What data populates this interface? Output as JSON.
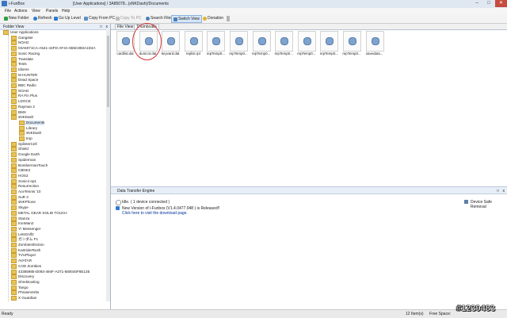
{
  "titlebar": {
    "app_title": "i-FunBox",
    "path": "[User Applications] / 3A85078...(sNKDash)/Documents"
  },
  "menu": [
    "File",
    "Actions",
    "View",
    "Panels",
    "Help"
  ],
  "toolbar": [
    {
      "label": "New Folder",
      "color": "#2f9e44"
    },
    {
      "label": "Refresh",
      "color": "#2b7bd1"
    },
    {
      "label": "Go Up Level",
      "color": "#2b7bd1"
    },
    {
      "label": "Copy From PC",
      "color": "#5b8fc7"
    },
    {
      "label": "Copy To PC",
      "color": "#9a9a9a",
      "disabled": true
    },
    {
      "label": "Search Files",
      "color": "#4b7fb5"
    },
    {
      "label": "Switch View",
      "color": "#4b7fb5",
      "active": true
    },
    {
      "label": "Donation",
      "color": "#e3b330"
    }
  ],
  "folder_view": {
    "title": "Folder View",
    "items": [
      {
        "label": "User Applications",
        "depth": 0
      },
      {
        "label": "Gangster",
        "depth": 1
      },
      {
        "label": "NOAD",
        "depth": 1
      },
      {
        "label": "03A5071CA-A541-44FD-AF4A-555C893A1D4A",
        "depth": 1
      },
      {
        "label": "Sonic Racing",
        "depth": 1
      },
      {
        "label": "Translate",
        "depth": 1
      },
      {
        "label": "Tests",
        "depth": 1
      },
      {
        "label": "Idioms",
        "depth": 1
      },
      {
        "label": "M HUNTER",
        "depth": 1
      },
      {
        "label": "Dead Space",
        "depth": 1
      },
      {
        "label": "BBC Radio",
        "depth": 1
      },
      {
        "label": "NOAD",
        "depth": 1
      },
      {
        "label": "RA Fin Plus",
        "depth": 1
      },
      {
        "label": "LDOCE",
        "depth": 1
      },
      {
        "label": "Rayman 2",
        "depth": 1
      },
      {
        "label": "BMX",
        "depth": 1
      },
      {
        "label": "sNKDash",
        "depth": 1
      },
      {
        "label": "Documents",
        "depth": 2,
        "selected": true
      },
      {
        "label": "Library",
        "depth": 2
      },
      {
        "label": "sNKDash",
        "depth": 2
      },
      {
        "label": "tmp",
        "depth": 2
      },
      {
        "label": "SplinterCell",
        "depth": 1
      },
      {
        "label": "Shield",
        "depth": 1
      },
      {
        "label": "Google Earth",
        "depth": 1
      },
      {
        "label": "Spiderman",
        "depth": 1
      },
      {
        "label": "BombermanTouch",
        "depth": 1
      },
      {
        "label": "CBNK2",
        "depth": 1
      },
      {
        "label": "HOS2",
        "depth": 1
      },
      {
        "label": "Sonic4 ep1",
        "depth": 1
      },
      {
        "label": "Resurrection",
        "depth": 1
      },
      {
        "label": "AceTennis '10",
        "depth": 1
      },
      {
        "label": "SuR 3",
        "depth": 1
      },
      {
        "label": "sNKPhone",
        "depth": 1
      },
      {
        "label": "Skype",
        "depth": 1
      },
      {
        "label": "METAL GEAR SOLID TOUCH",
        "depth": 1
      },
      {
        "label": "Stanza",
        "depth": 1
      },
      {
        "label": "IronMan2",
        "depth": 1
      },
      {
        "label": "Y! Messenger",
        "depth": 1
      },
      {
        "label": "LetsGolf2",
        "depth": 1
      },
      {
        "label": "ガンダム F1",
        "depth": 1
      },
      {
        "label": "ZombieInfection",
        "depth": 1
      },
      {
        "label": "KartriderRush",
        "depth": 1
      },
      {
        "label": "TVUPlayer",
        "depth": 1
      },
      {
        "label": "AVATAR",
        "depth": 1
      },
      {
        "label": "COD Zombies",
        "depth": 1
      },
      {
        "label": "43385985-D093-494F-A371-580040F8E135",
        "depth": 1
      },
      {
        "label": "Discovery",
        "depth": 1
      },
      {
        "label": "ShrekKarting",
        "depth": 1
      },
      {
        "label": "Tango",
        "depth": 1
      },
      {
        "label": "PhraseVerbs",
        "depth": 1
      },
      {
        "label": "X Guardian",
        "depth": 1
      }
    ]
  },
  "file_view": {
    "tabs": [
      {
        "label": "File View"
      },
      {
        "label": "Thumbnails",
        "active": true
      }
    ],
    "files": [
      "cardlist.dat",
      "dumcnt.dat",
      "keyvard.dat",
      "replist.rpl",
      "repTemp0...",
      "repTemp0...",
      "repTemp0...",
      "repTemp0...",
      "repTemp0...",
      "repTemp0...",
      "repTemp0...",
      "savedata..."
    ]
  },
  "transfer": {
    "title": "Data Transfer Engine",
    "status": "Idle. ( 1 device connected )",
    "notice_line1": "New Version of i-Funbox (V1.4.0477.048 ) is Released!!",
    "notice_line2": "Click here to visit the download page.",
    "safe_removal": "Device Safe Removal"
  },
  "status": {
    "left": "Ready",
    "items": "12 Item(s)",
    "free_space": "Free Space:"
  },
  "watermark": "#1239483"
}
